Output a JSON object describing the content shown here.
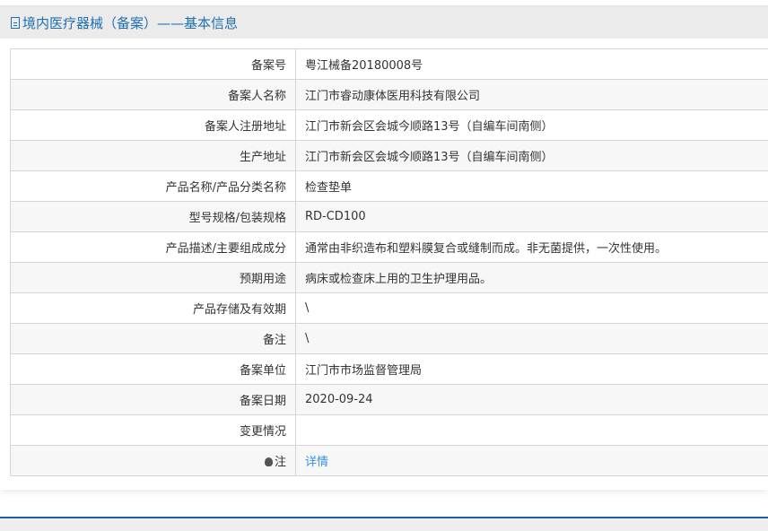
{
  "title": "境内医疗器械（备案）——基本信息",
  "rows": [
    {
      "label": "备案号",
      "value": "粤江械备20180008号"
    },
    {
      "label": "备案人名称",
      "value": "江门市睿动康体医用科技有限公司"
    },
    {
      "label": "备案人注册地址",
      "value": "江门市新会区会城今顺路13号（自编车间南侧）"
    },
    {
      "label": "生产地址",
      "value": "江门市新会区会城今顺路13号（自编车间南侧）"
    },
    {
      "label": "产品名称/产品分类名称",
      "value": "检查垫单"
    },
    {
      "label": "型号规格/包装规格",
      "value": "RD-CD100"
    },
    {
      "label": "产品描述/主要组成成分",
      "value": "通常由非织造布和塑料膜复合或缝制而成。非无菌提供，一次性使用。"
    },
    {
      "label": "预期用途",
      "value": "病床或检查床上用的卫生护理用品。"
    },
    {
      "label": "产品存储及有效期",
      "value": "\\"
    },
    {
      "label": "备注",
      "value": "\\"
    },
    {
      "label": "备案单位",
      "value": "江门市市场监督管理局"
    },
    {
      "label": "备案日期",
      "value": "2020-09-24"
    },
    {
      "label": "变更情况",
      "value": ""
    }
  ],
  "note": {
    "label": "注",
    "link": "详情"
  }
}
